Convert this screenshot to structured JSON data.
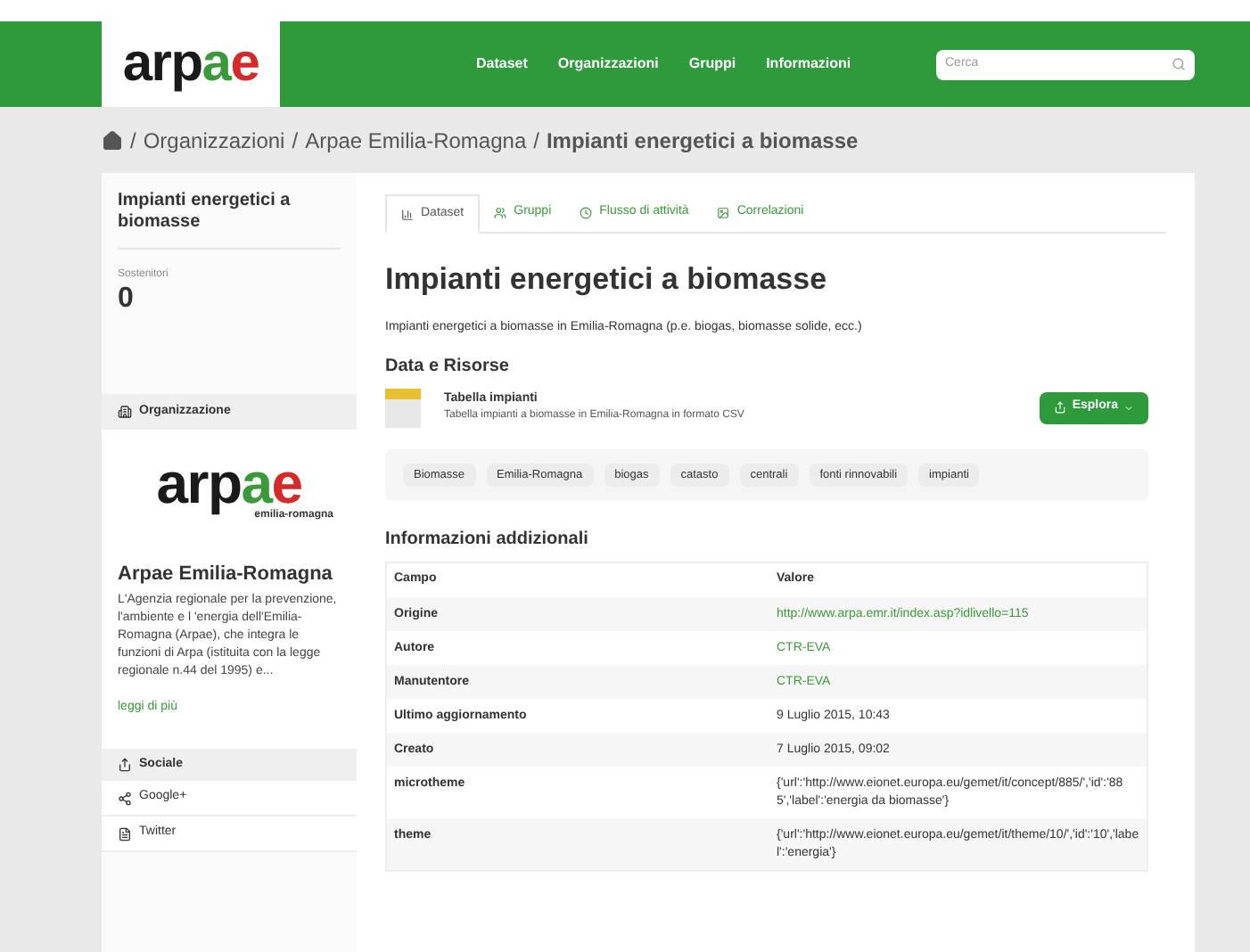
{
  "header": {
    "logo": [
      "arp",
      "a",
      "e"
    ],
    "nav": [
      {
        "label": "Dataset"
      },
      {
        "label": "Organizzazioni"
      },
      {
        "label": "Gruppi"
      },
      {
        "label": "Informazioni"
      }
    ],
    "search": {
      "placeholder": "Cerca"
    }
  },
  "breadcrumb": {
    "separator": "/",
    "items": [
      "Organizzazioni",
      "Arpae Emilia-Romagna"
    ],
    "current": "Impianti energetici a biomasse"
  },
  "sidebar": {
    "title": "Impianti energetici a biomasse",
    "followers_label": "Sostenitori",
    "followers": "0",
    "organization": {
      "heading": "Organizzazione",
      "logo": [
        "arp",
        "a",
        "e"
      ],
      "logo_subtitle": "emilia-romagna",
      "name": "Arpae Emilia-Romagna",
      "description": "L'Agenzia regionale per la prevenzione, l'ambiente e l 'energia dell'Emilia-Romagna (Arpae), che integra le funzioni di Arpa (istituita con la legge regionale n.44 del 1995) e...",
      "more": "leggi di più"
    },
    "social": {
      "heading": "Sociale",
      "items": [
        {
          "kind": "google",
          "label": "Google+"
        },
        {
          "kind": "twitter",
          "label": "Twitter"
        }
      ]
    }
  },
  "tabs": [
    {
      "kind": "dataset",
      "label": "Dataset",
      "selected": true
    },
    {
      "kind": "groups",
      "label": "Gruppi",
      "selected": false
    },
    {
      "kind": "activity",
      "label": "Flusso di attività",
      "selected": false
    },
    {
      "kind": "related",
      "label": "Correlazioni",
      "selected": false
    }
  ],
  "dataset": {
    "title": "Impianti energetici a biomasse",
    "description": "Impianti energetici a biomasse in Emilia-Romagna (p.e. biogas, biomasse solide, ecc.)",
    "resources_heading": "Data e Risorse",
    "resources": [
      {
        "name": "Tabella impianti",
        "description": "Tabella impianti a biomasse in Emilia-Romagna in formato CSV",
        "button": "Esplora"
      }
    ],
    "tags": [
      "Biomasse",
      "Emilia-Romagna",
      "biogas",
      "catasto",
      "centrali",
      "fonti rinnovabili",
      "impianti"
    ],
    "info_heading": "Informazioni addizionali",
    "table": {
      "columns": [
        "Campo",
        "Valore"
      ],
      "rows": [
        {
          "field": "Origine",
          "value": "http://www.arpa.emr.it/index.asp?idlivello=115",
          "kind": "link"
        },
        {
          "field": "Autore",
          "value": "CTR-EVA",
          "kind": "link"
        },
        {
          "field": "Manutentore",
          "value": "CTR-EVA",
          "kind": "link"
        },
        {
          "field": "Ultimo aggiornamento",
          "value": "9 Luglio 2015, 10:43",
          "kind": "text"
        },
        {
          "field": "Creato",
          "value": "7 Luglio 2015, 09:02",
          "kind": "text"
        },
        {
          "field": "microtheme",
          "value": "{'url':'http://www.eionet.europa.eu/gemet/it/concept/885/','id':'885','label':'energia da biomasse'}",
          "kind": "text"
        },
        {
          "field": "theme",
          "value": "{'url':'http://www.eionet.europa.eu/gemet/it/theme/10/','id':'10','label':'energia'}",
          "kind": "text"
        }
      ]
    }
  }
}
